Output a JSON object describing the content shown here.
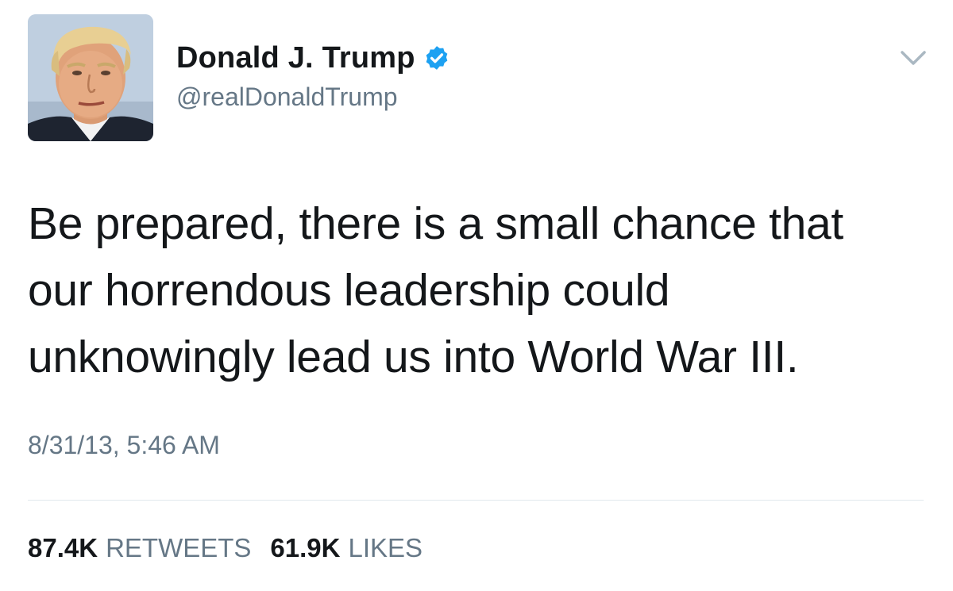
{
  "author": {
    "display_name": "Donald J. Trump",
    "handle": "@realDonaldTrump",
    "verified": true,
    "verified_icon": "verified-badge-icon",
    "verified_color": "#1da1f2"
  },
  "tweet": {
    "lines": [
      "Be prepared, there is a small chance that",
      "our horrendous leadership could",
      "unknowingly lead us into World War III."
    ],
    "timestamp": "8/31/13, 5:46 AM"
  },
  "stats": {
    "retweets_count": "87.4K",
    "retweets_label": "RETWEETS",
    "likes_count": "61.9K",
    "likes_label": "LIKES"
  },
  "menu": {
    "icon": "chevron-down-icon"
  },
  "colors": {
    "text_primary": "#14171a",
    "text_secondary": "#657786",
    "divider": "#e1e8ed"
  }
}
